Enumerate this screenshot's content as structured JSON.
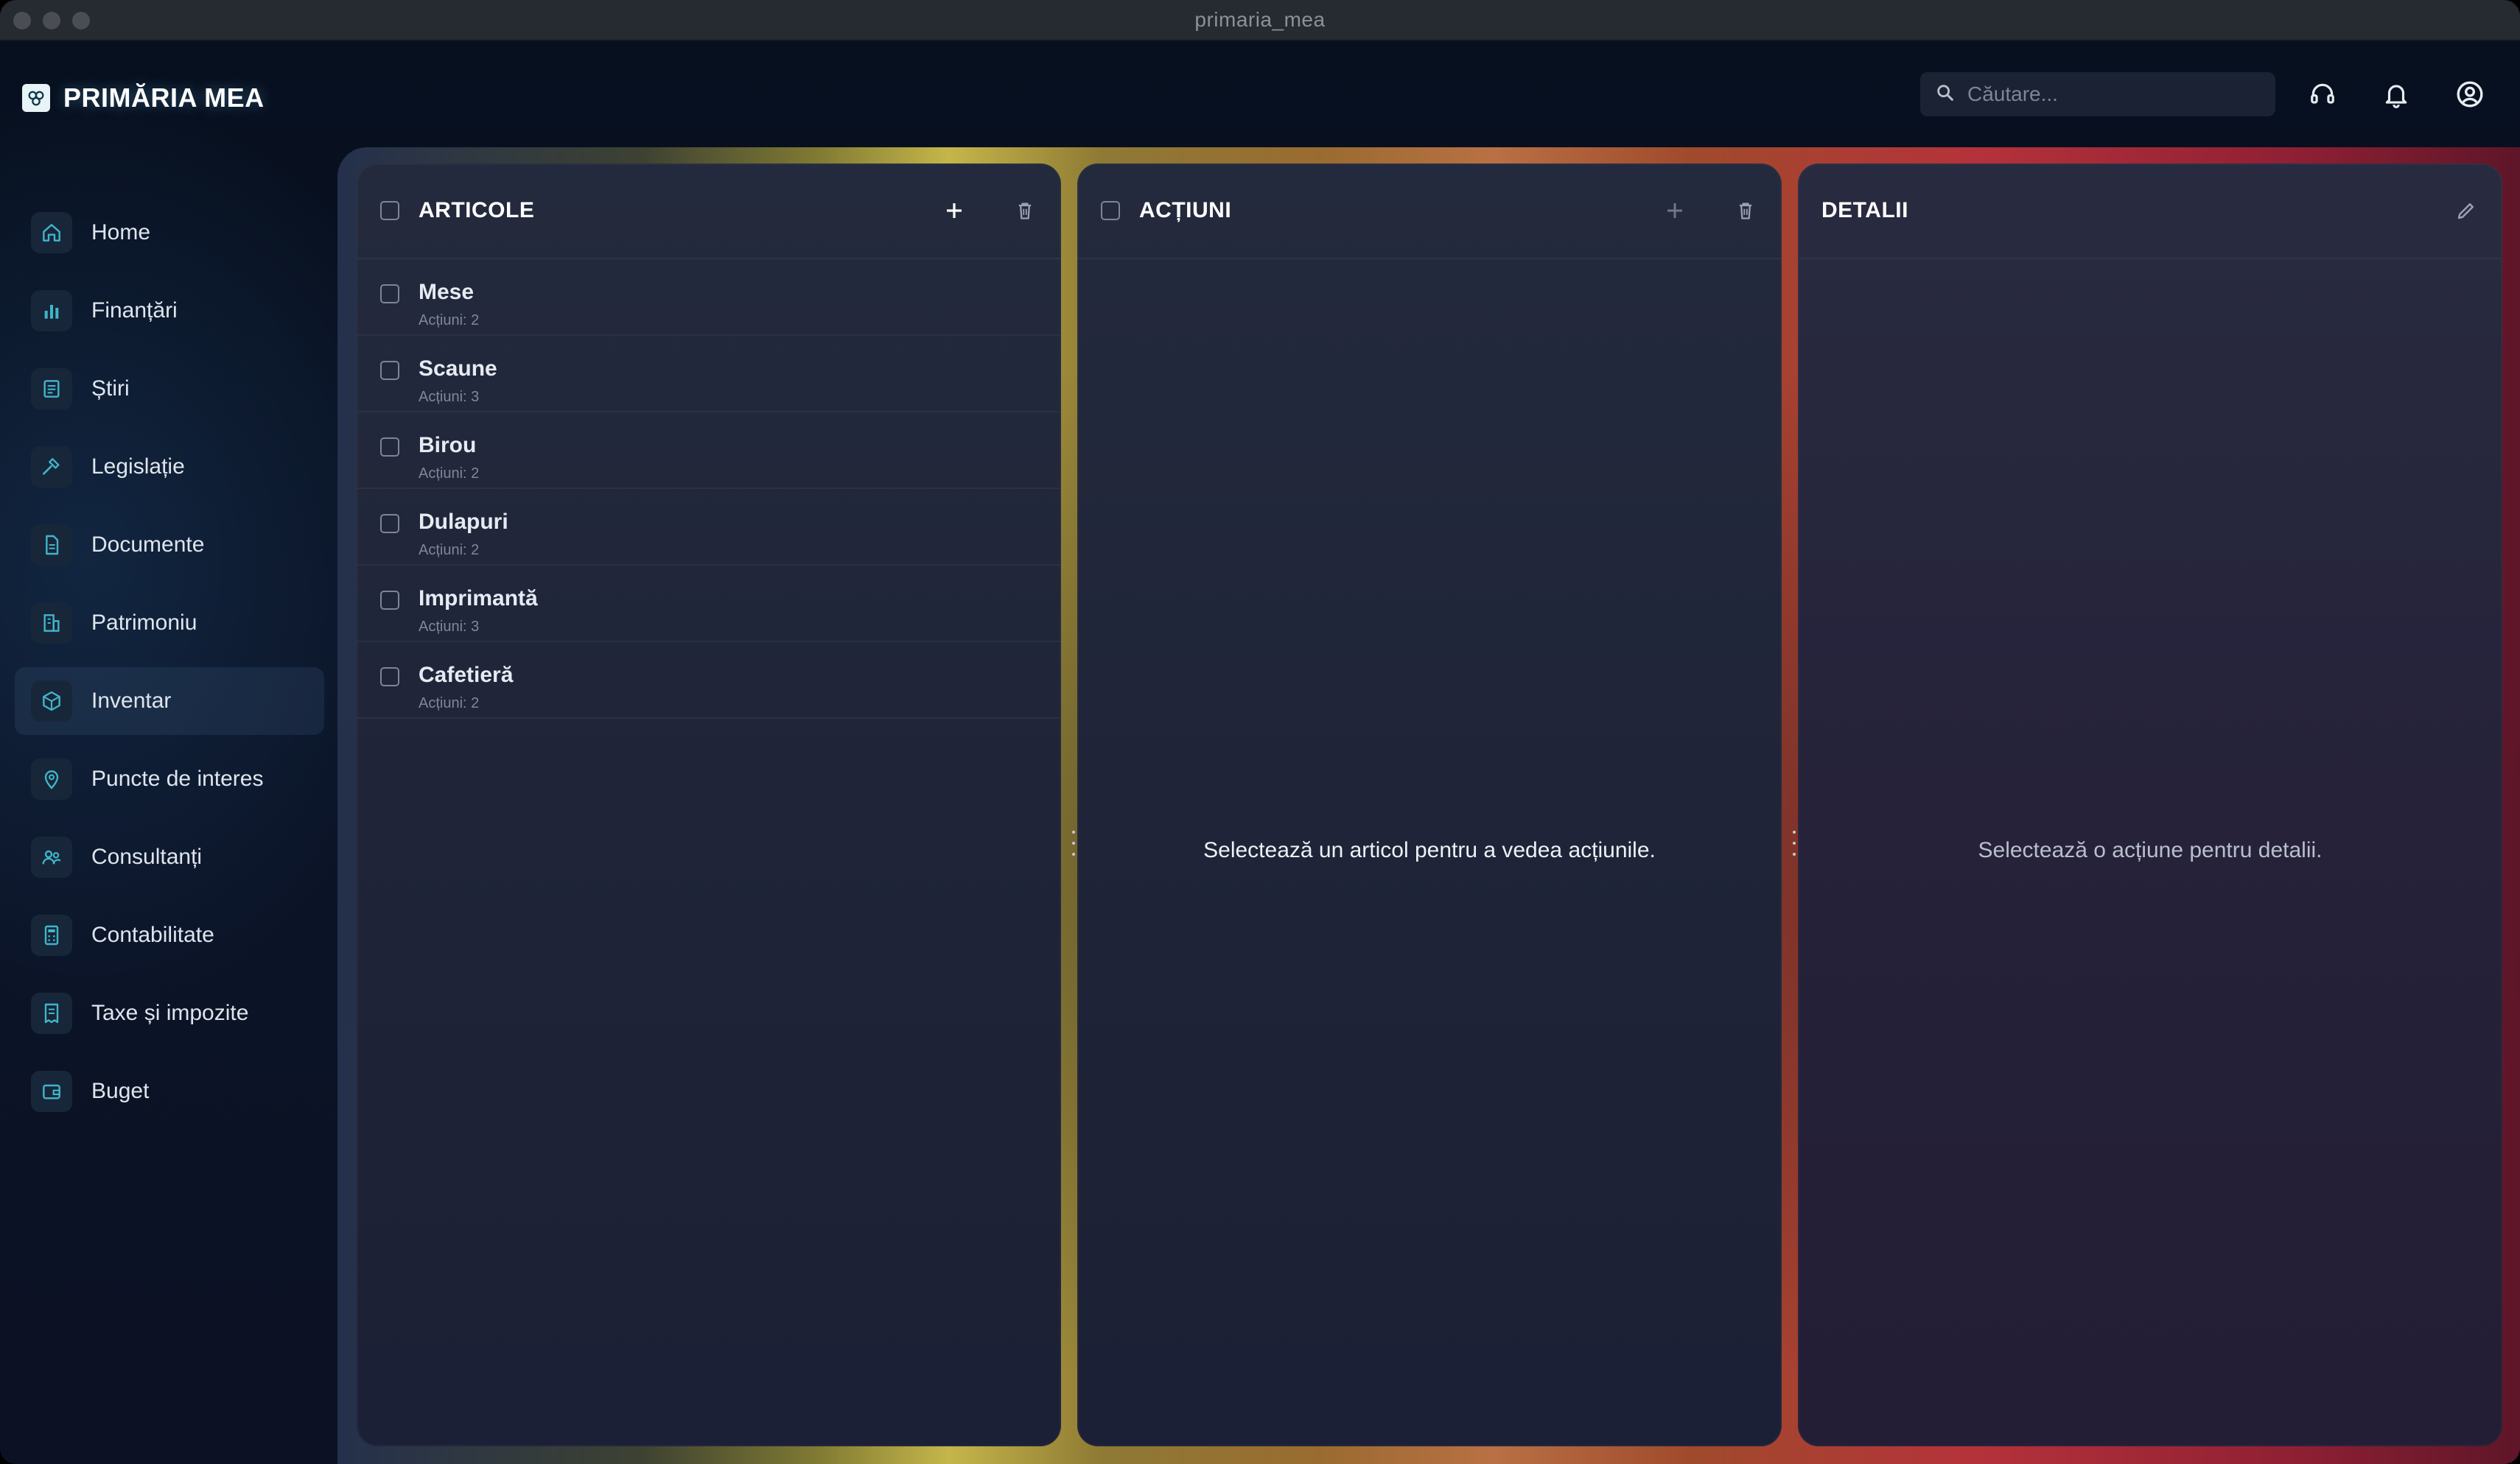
{
  "window": {
    "title": "primaria_mea"
  },
  "brand": {
    "name": "PRIMĂRIA MEA"
  },
  "search": {
    "placeholder": "Căutare..."
  },
  "header_icons": [
    "headset-icon",
    "bell-icon",
    "user-circle-icon"
  ],
  "sidebar": {
    "items": [
      {
        "label": "Home",
        "icon": "home-icon"
      },
      {
        "label": "Finanțări",
        "icon": "bar-chart-icon"
      },
      {
        "label": "Știri",
        "icon": "newspaper-icon"
      },
      {
        "label": "Legislație",
        "icon": "gavel-icon"
      },
      {
        "label": "Documente",
        "icon": "document-icon"
      },
      {
        "label": "Patrimoniu",
        "icon": "building-icon"
      },
      {
        "label": "Inventar",
        "icon": "box-icon",
        "active": true
      },
      {
        "label": "Puncte de interes",
        "icon": "map-pin-icon"
      },
      {
        "label": "Consultanți",
        "icon": "users-icon"
      },
      {
        "label": "Contabilitate",
        "icon": "calculator-icon"
      },
      {
        "label": "Taxe și impozite",
        "icon": "receipt-icon"
      },
      {
        "label": "Buget",
        "icon": "wallet-icon"
      }
    ]
  },
  "panels": {
    "articole": {
      "title": "ARTICOLE",
      "items": [
        {
          "name": "Mese",
          "sub": "Acțiuni: 2"
        },
        {
          "name": "Scaune",
          "sub": "Acțiuni: 3"
        },
        {
          "name": "Birou",
          "sub": "Acțiuni: 2"
        },
        {
          "name": "Dulapuri",
          "sub": "Acțiuni: 2"
        },
        {
          "name": "Imprimantă",
          "sub": "Acțiuni: 3"
        },
        {
          "name": "Cafetieră",
          "sub": "Acțiuni: 2"
        }
      ]
    },
    "actiuni": {
      "title": "ACȚIUNI",
      "empty": "Selectează un articol pentru a vedea acțiunile."
    },
    "detalii": {
      "title": "DETALII",
      "empty": "Selectează o acțiune pentru detalii."
    }
  },
  "colors": {
    "accent": "#3fb6c8",
    "panel_bg": "#1f2438",
    "frame_left": "#24304c",
    "frame_mid": "#c5b64a",
    "frame_right": "#b5323a"
  }
}
